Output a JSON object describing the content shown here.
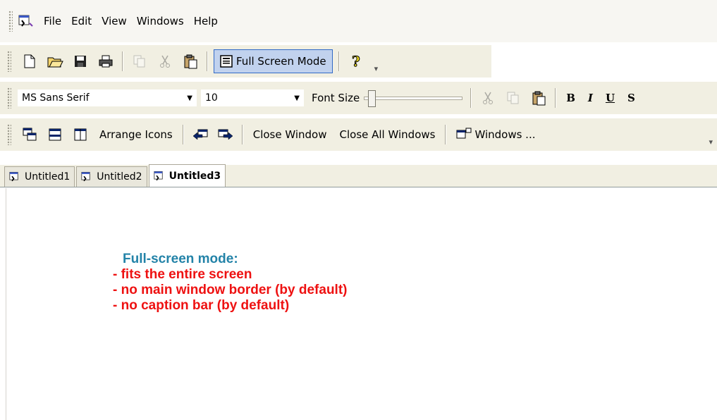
{
  "menu": {
    "items": [
      "File",
      "Edit",
      "View",
      "Windows",
      "Help"
    ]
  },
  "toolbar_standard": {
    "full_screen_label": "Full Screen Mode"
  },
  "toolbar_format": {
    "font_name": "MS Sans Serif",
    "font_size": "10",
    "font_size_label": "Font Size",
    "bold": "B",
    "italic": "I",
    "underline": "U"
  },
  "toolbar_windows": {
    "arrange_icons": "Arrange Icons",
    "close_window": "Close Window",
    "close_all": "Close All Windows",
    "windows_menu": "Windows ..."
  },
  "tabs": [
    "Untitled1",
    "Untitled2",
    "Untitled3"
  ],
  "document": {
    "heading": "Full-screen mode:",
    "lines": [
      "- fits the entire screen",
      "- no main window border (by default)",
      "- no caption bar (by default)"
    ],
    "heading_color": "#2383a8",
    "line_color": "#ee1111"
  }
}
